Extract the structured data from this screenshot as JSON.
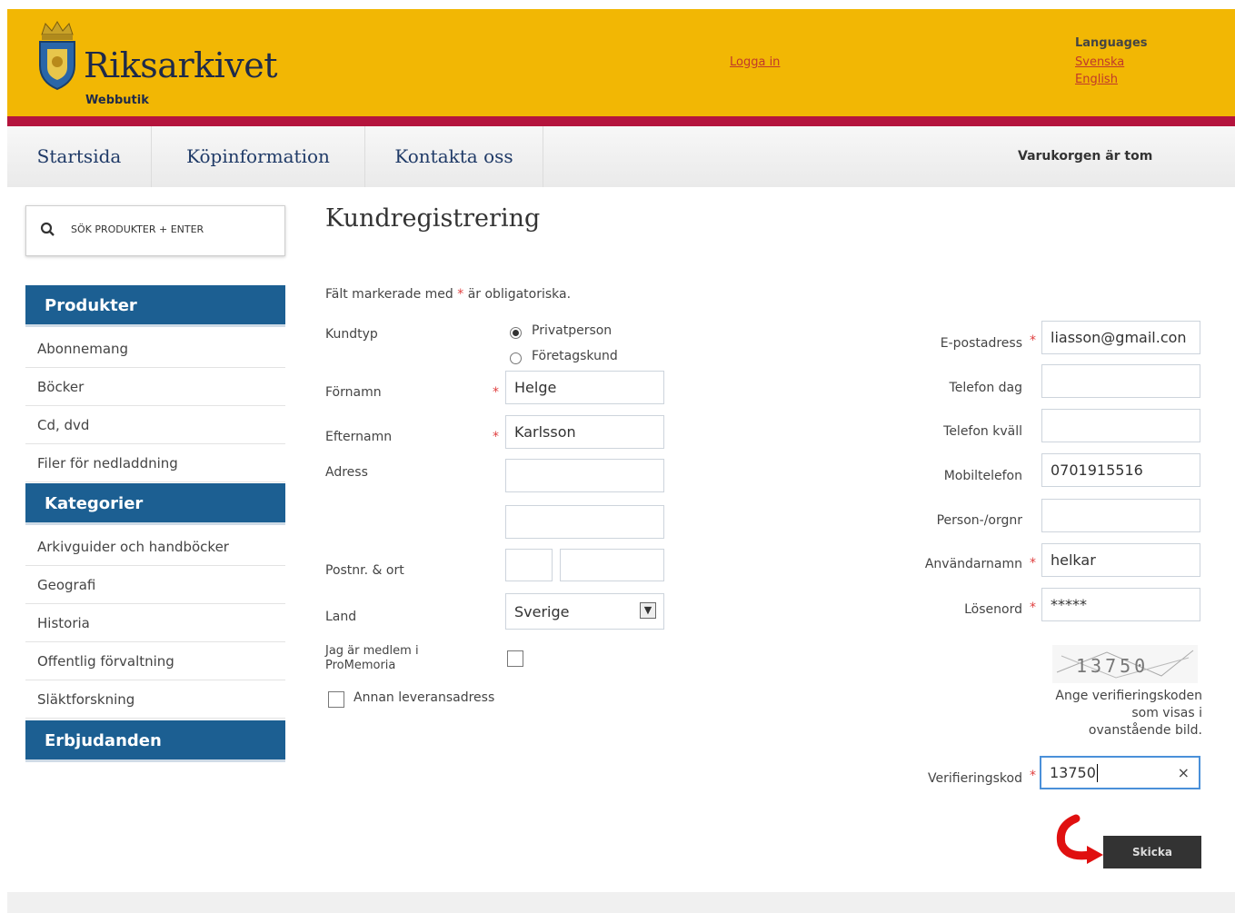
{
  "header": {
    "logo_text": "Riksarkivet",
    "logo_sub": "Webbutik",
    "login": "Logga in",
    "languages_title": "Languages",
    "lang_sv": "Svenska",
    "lang_en": "English"
  },
  "nav": {
    "tabs": [
      "Startsida",
      "Köpinformation",
      "Kontakta oss"
    ],
    "cart": "Varukorgen är tom"
  },
  "sidebar": {
    "search_placeholder": "SÖK PRODUKTER + ENTER",
    "sections": [
      {
        "title": "Produkter",
        "items": [
          "Abonnemang",
          "Böcker",
          "Cd, dvd",
          "Filer för nedladdning"
        ]
      },
      {
        "title": "Kategorier",
        "items": [
          "Arkivguider och handböcker",
          "Geografi",
          "Historia",
          "Offentlig förvaltning",
          "Släktforskning"
        ]
      },
      {
        "title": "Erbjudanden",
        "items": []
      }
    ]
  },
  "form": {
    "title": "Kundregistrering",
    "required_note_pre": "Fält markerade med",
    "required_note_post": "är obligatoriska.",
    "required_mark": "*",
    "kundtyp_label": "Kundtyp",
    "kundtyp_options": [
      "Privatperson",
      "Företagskund"
    ],
    "kundtyp_selected": "Privatperson",
    "fornamn_label": "Förnamn",
    "fornamn_value": "Helge",
    "efternamn_label": "Efternamn",
    "efternamn_value": "Karlsson",
    "adress_label": "Adress",
    "postnr_label": "Postnr. & ort",
    "land_label": "Land",
    "land_value": "Sverige",
    "medlem_label": "Jag är medlem i ProMemoria",
    "annan_label": "Annan leveransadress",
    "epost_label": "E-postadress",
    "epost_value": "liasson@gmail.con",
    "tel_dag_label": "Telefon dag",
    "tel_kvall_label": "Telefon kväll",
    "mobil_label": "Mobiltelefon",
    "mobil_value": "0701915516",
    "person_label": "Person-/orgnr",
    "user_label": "Användarnamn",
    "user_value": "helkar",
    "pass_label": "Lösenord",
    "pass_value": "*****",
    "captcha_image_text": "13750",
    "captcha_help": "Ange verifieringskoden som visas i ovanstående bild.",
    "verif_label": "Verifieringskod",
    "verif_value": "13750",
    "clear_glyph": "×",
    "submit": "Skicka"
  }
}
